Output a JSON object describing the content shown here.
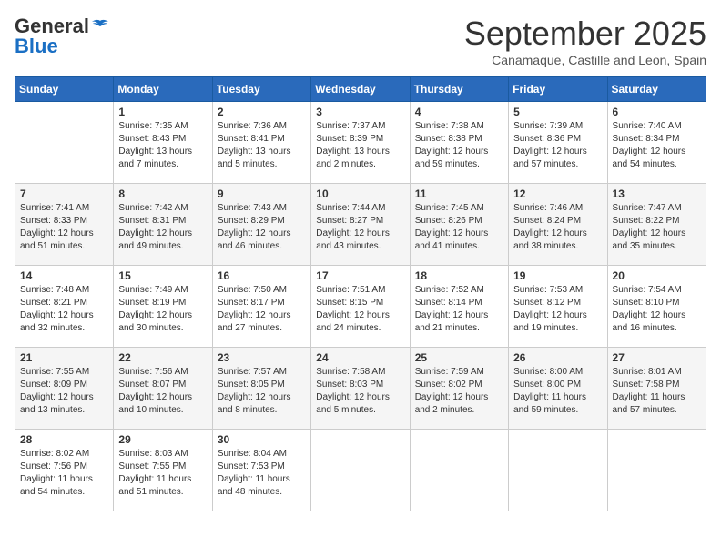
{
  "header": {
    "logo_line1": "General",
    "logo_line2": "Blue",
    "month_title": "September 2025",
    "subtitle": "Canamaque, Castille and Leon, Spain"
  },
  "weekdays": [
    "Sunday",
    "Monday",
    "Tuesday",
    "Wednesday",
    "Thursday",
    "Friday",
    "Saturday"
  ],
  "weeks": [
    [
      {
        "day": "",
        "sunrise": "",
        "sunset": "",
        "daylight": ""
      },
      {
        "day": "1",
        "sunrise": "Sunrise: 7:35 AM",
        "sunset": "Sunset: 8:43 PM",
        "daylight": "Daylight: 13 hours and 7 minutes."
      },
      {
        "day": "2",
        "sunrise": "Sunrise: 7:36 AM",
        "sunset": "Sunset: 8:41 PM",
        "daylight": "Daylight: 13 hours and 5 minutes."
      },
      {
        "day": "3",
        "sunrise": "Sunrise: 7:37 AM",
        "sunset": "Sunset: 8:39 PM",
        "daylight": "Daylight: 13 hours and 2 minutes."
      },
      {
        "day": "4",
        "sunrise": "Sunrise: 7:38 AM",
        "sunset": "Sunset: 8:38 PM",
        "daylight": "Daylight: 12 hours and 59 minutes."
      },
      {
        "day": "5",
        "sunrise": "Sunrise: 7:39 AM",
        "sunset": "Sunset: 8:36 PM",
        "daylight": "Daylight: 12 hours and 57 minutes."
      },
      {
        "day": "6",
        "sunrise": "Sunrise: 7:40 AM",
        "sunset": "Sunset: 8:34 PM",
        "daylight": "Daylight: 12 hours and 54 minutes."
      }
    ],
    [
      {
        "day": "7",
        "sunrise": "Sunrise: 7:41 AM",
        "sunset": "Sunset: 8:33 PM",
        "daylight": "Daylight: 12 hours and 51 minutes."
      },
      {
        "day": "8",
        "sunrise": "Sunrise: 7:42 AM",
        "sunset": "Sunset: 8:31 PM",
        "daylight": "Daylight: 12 hours and 49 minutes."
      },
      {
        "day": "9",
        "sunrise": "Sunrise: 7:43 AM",
        "sunset": "Sunset: 8:29 PM",
        "daylight": "Daylight: 12 hours and 46 minutes."
      },
      {
        "day": "10",
        "sunrise": "Sunrise: 7:44 AM",
        "sunset": "Sunset: 8:27 PM",
        "daylight": "Daylight: 12 hours and 43 minutes."
      },
      {
        "day": "11",
        "sunrise": "Sunrise: 7:45 AM",
        "sunset": "Sunset: 8:26 PM",
        "daylight": "Daylight: 12 hours and 41 minutes."
      },
      {
        "day": "12",
        "sunrise": "Sunrise: 7:46 AM",
        "sunset": "Sunset: 8:24 PM",
        "daylight": "Daylight: 12 hours and 38 minutes."
      },
      {
        "day": "13",
        "sunrise": "Sunrise: 7:47 AM",
        "sunset": "Sunset: 8:22 PM",
        "daylight": "Daylight: 12 hours and 35 minutes."
      }
    ],
    [
      {
        "day": "14",
        "sunrise": "Sunrise: 7:48 AM",
        "sunset": "Sunset: 8:21 PM",
        "daylight": "Daylight: 12 hours and 32 minutes."
      },
      {
        "day": "15",
        "sunrise": "Sunrise: 7:49 AM",
        "sunset": "Sunset: 8:19 PM",
        "daylight": "Daylight: 12 hours and 30 minutes."
      },
      {
        "day": "16",
        "sunrise": "Sunrise: 7:50 AM",
        "sunset": "Sunset: 8:17 PM",
        "daylight": "Daylight: 12 hours and 27 minutes."
      },
      {
        "day": "17",
        "sunrise": "Sunrise: 7:51 AM",
        "sunset": "Sunset: 8:15 PM",
        "daylight": "Daylight: 12 hours and 24 minutes."
      },
      {
        "day": "18",
        "sunrise": "Sunrise: 7:52 AM",
        "sunset": "Sunset: 8:14 PM",
        "daylight": "Daylight: 12 hours and 21 minutes."
      },
      {
        "day": "19",
        "sunrise": "Sunrise: 7:53 AM",
        "sunset": "Sunset: 8:12 PM",
        "daylight": "Daylight: 12 hours and 19 minutes."
      },
      {
        "day": "20",
        "sunrise": "Sunrise: 7:54 AM",
        "sunset": "Sunset: 8:10 PM",
        "daylight": "Daylight: 12 hours and 16 minutes."
      }
    ],
    [
      {
        "day": "21",
        "sunrise": "Sunrise: 7:55 AM",
        "sunset": "Sunset: 8:09 PM",
        "daylight": "Daylight: 12 hours and 13 minutes."
      },
      {
        "day": "22",
        "sunrise": "Sunrise: 7:56 AM",
        "sunset": "Sunset: 8:07 PM",
        "daylight": "Daylight: 12 hours and 10 minutes."
      },
      {
        "day": "23",
        "sunrise": "Sunrise: 7:57 AM",
        "sunset": "Sunset: 8:05 PM",
        "daylight": "Daylight: 12 hours and 8 minutes."
      },
      {
        "day": "24",
        "sunrise": "Sunrise: 7:58 AM",
        "sunset": "Sunset: 8:03 PM",
        "daylight": "Daylight: 12 hours and 5 minutes."
      },
      {
        "day": "25",
        "sunrise": "Sunrise: 7:59 AM",
        "sunset": "Sunset: 8:02 PM",
        "daylight": "Daylight: 12 hours and 2 minutes."
      },
      {
        "day": "26",
        "sunrise": "Sunrise: 8:00 AM",
        "sunset": "Sunset: 8:00 PM",
        "daylight": "Daylight: 11 hours and 59 minutes."
      },
      {
        "day": "27",
        "sunrise": "Sunrise: 8:01 AM",
        "sunset": "Sunset: 7:58 PM",
        "daylight": "Daylight: 11 hours and 57 minutes."
      }
    ],
    [
      {
        "day": "28",
        "sunrise": "Sunrise: 8:02 AM",
        "sunset": "Sunset: 7:56 PM",
        "daylight": "Daylight: 11 hours and 54 minutes."
      },
      {
        "day": "29",
        "sunrise": "Sunrise: 8:03 AM",
        "sunset": "Sunset: 7:55 PM",
        "daylight": "Daylight: 11 hours and 51 minutes."
      },
      {
        "day": "30",
        "sunrise": "Sunrise: 8:04 AM",
        "sunset": "Sunset: 7:53 PM",
        "daylight": "Daylight: 11 hours and 48 minutes."
      },
      {
        "day": "",
        "sunrise": "",
        "sunset": "",
        "daylight": ""
      },
      {
        "day": "",
        "sunrise": "",
        "sunset": "",
        "daylight": ""
      },
      {
        "day": "",
        "sunrise": "",
        "sunset": "",
        "daylight": ""
      },
      {
        "day": "",
        "sunrise": "",
        "sunset": "",
        "daylight": ""
      }
    ]
  ]
}
